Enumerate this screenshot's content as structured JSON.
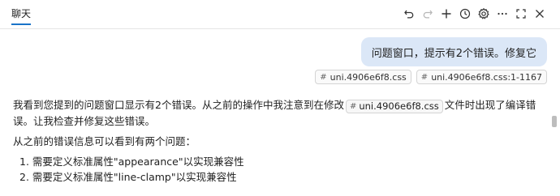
{
  "header": {
    "tab_label": "聊天"
  },
  "toolbar": {
    "undo_icon": "undo-icon",
    "redo_icon": "redo-icon",
    "add_icon": "plus-icon",
    "history_icon": "history-icon",
    "settings_icon": "gear-icon",
    "more_icon": "ellipsis-icon",
    "maximize_icon": "maximize-icon",
    "close_icon": "close-icon"
  },
  "user_message": {
    "text": "问题窗口，提示有2个错误。修复它",
    "references": [
      {
        "hash": "#",
        "label": "uni.4906e6f8.css"
      },
      {
        "hash": "#",
        "label": "uni.4906e6f8.css:1-1167"
      }
    ]
  },
  "assistant_message": {
    "para1_before": "我看到您提到的问题窗口显示有2个错误。从之前的操作中我注意到在修改",
    "para1_chip_hash": "#",
    "para1_chip": "uni.4906e6f8.css",
    "para1_after": "文件时出现了编译错误。让我检查并修复这些错误。",
    "para2": "从之前的错误信息可以看到有两个问题：",
    "items": [
      "1. 需要定义标准属性\"appearance\"以实现兼容性",
      "2. 需要定义标准属性\"line-clamp\"以实现兼容性"
    ]
  },
  "colors": {
    "accent": "#1a73c8",
    "user_bubble": "#dbe7f7"
  }
}
